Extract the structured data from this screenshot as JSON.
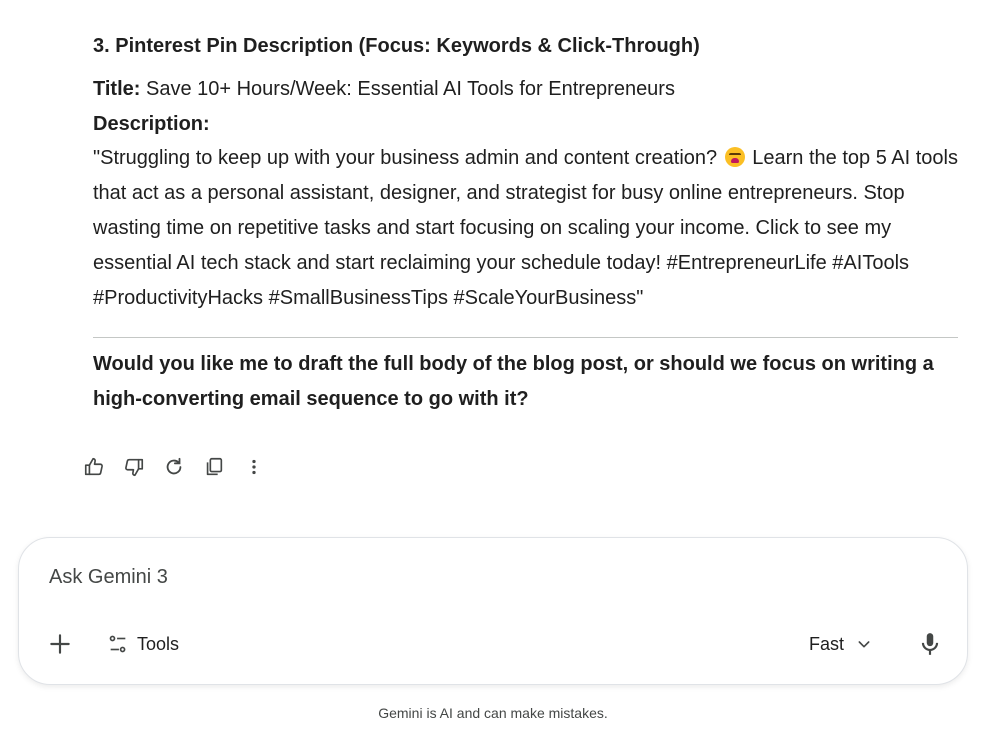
{
  "response": {
    "section_heading": "3. Pinterest Pin Description (Focus: Keywords & Click-Through)",
    "title_label": "Title:",
    "title_value": "Save 10+ Hours/Week: Essential AI Tools for Entrepreneurs",
    "description_label": "Description:",
    "description_part1": "\"Struggling to keep up with your business admin and content creation?",
    "description_part2": "Learn the top 5 AI tools that act as a personal assistant, designer, and strategist for busy online entrepreneurs. Stop wasting time on repetitive tasks and start focusing on scaling your income. Click to see my essential AI tech stack and start reclaiming your schedule today! #EntrepreneurLife #AITools #ProductivityHacks #SmallBusinessTips #ScaleYourBusiness\"",
    "closing_question": "Would you like me to draft the full body of the blog post, or should we focus on writing a high-converting email sequence to go with it?"
  },
  "actions": [
    {
      "icon": "thumbs-up-icon"
    },
    {
      "icon": "thumbs-down-icon"
    },
    {
      "icon": "refresh-icon"
    },
    {
      "icon": "copy-icon"
    },
    {
      "icon": "more-vert-icon"
    }
  ],
  "composer": {
    "placeholder": "Ask Gemini 3",
    "tools_label": "Tools",
    "mode_label": "Fast"
  },
  "disclaimer": "Gemini is AI and can make mistakes."
}
